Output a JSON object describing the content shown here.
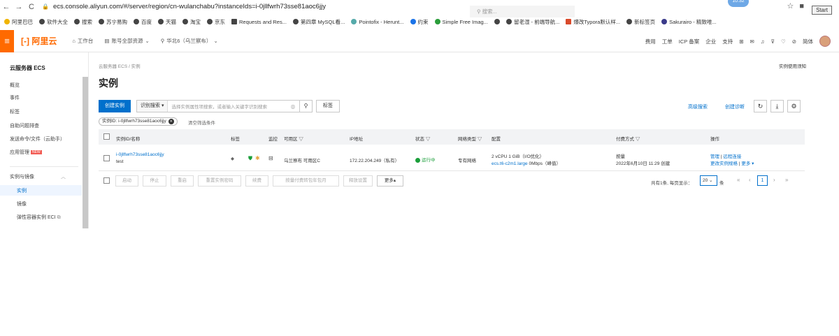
{
  "browser": {
    "url": "ecs.console.aliyun.com/#/server/region/cn-wulanchabu?instanceIds=i-0jllfwrh73sse81aoc6jjy",
    "start_label": "Start",
    "badge": "10:32"
  },
  "bookmarks": [
    "阿里巴巴",
    "软件大全",
    "搜索",
    "苏宁易购",
    "百度",
    "天猫",
    "淘宝",
    "京东",
    "Requests and Res...",
    "第四章 MySQL看...",
    "Pointofix - Herunt...",
    "约束",
    "Simple Free Imag...",
    "",
    "留老湿 - 前端导航...",
    "爆改Typora默认样...",
    "新标签页",
    "Sakurairo - 精致唯..."
  ],
  "topbar": {
    "logo": "阿里云",
    "workbench": "工作台",
    "account_resources": "账号全部资源",
    "region": "华北6（乌兰察布）",
    "search_placeholder": "搜索...",
    "links": [
      "费用",
      "工单",
      "ICP 备案",
      "企业",
      "支持",
      "简体"
    ]
  },
  "sidebar": {
    "title": "云服务器 ECS",
    "items": [
      "概览",
      "事件",
      "标签",
      "自助问题排查",
      "发送命令/文件（云助手）",
      "应用管理"
    ],
    "new_badge": "NEW",
    "group": "实例与镜像",
    "sub_items": [
      "实例",
      "镜像",
      "弹性容器实例 ECI"
    ]
  },
  "main": {
    "breadcrumb": "云服务器 ECS / 实例",
    "notice": "实例使用须知",
    "title": "实例",
    "create_btn": "创建实例",
    "search_mode": "识别搜索",
    "search_placeholder": "选择实例属性项搜索，或者输入关键字识别搜索",
    "tag_btn": "标签",
    "advanced_search": "高级搜索",
    "diagnose": "创建诊断",
    "filter_chip": "实例ID: i-0jllfwrh73sse81aoc6jjy",
    "clear_filters": "清空筛选条件"
  },
  "table": {
    "headers": [
      "实例ID/名称",
      "标签",
      "监控",
      "可用区",
      "IP地址",
      "状态",
      "网络类型",
      "配置",
      "付费方式",
      "操作"
    ],
    "row": {
      "id": "i-0jllfwrh73sse81aoc6jjy",
      "name": "test",
      "zone": "乌兰察布 可用区C",
      "ip": "172.22.204.249（私有）",
      "status": "运行中",
      "network": "专有网络",
      "spec1": "2 vCPU 1 GiB（I/O优化）",
      "spec2": "ecs.t6-c2m1.large",
      "spec3": "0Mbps（峰值）",
      "pay1": "按量",
      "pay2": "2022年6月10日 11:29 创建",
      "op1": "管理",
      "op2": "远程连接",
      "op3": "更改实例规格",
      "op4": "更多"
    }
  },
  "bottom": {
    "buttons": [
      "启动",
      "停止",
      "重启",
      "重置实例密码",
      "续费",
      "按量付费转包年包月",
      "释放设置"
    ],
    "more": "更多▴",
    "total": "共有1条, 每页显示：",
    "page_size": "20",
    "unit": "条",
    "current_page": "1"
  }
}
